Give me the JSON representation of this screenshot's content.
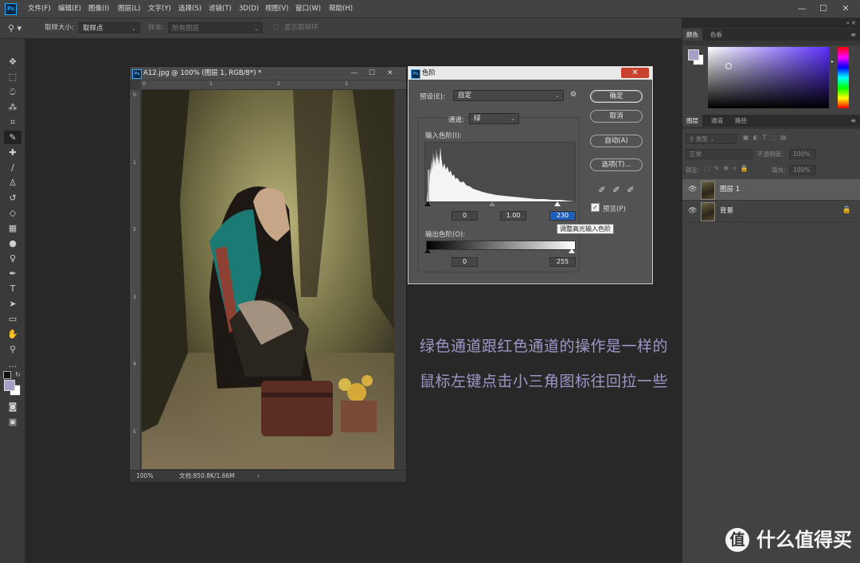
{
  "app": {
    "logo": "Ps"
  },
  "menu": [
    "文件(F)",
    "编辑(E)",
    "图像(I)",
    "图层(L)",
    "文字(Y)",
    "选择(S)",
    "滤镜(T)",
    "3D(D)",
    "视图(V)",
    "窗口(W)",
    "帮助(H)"
  ],
  "window_controls": {
    "minimize": "—",
    "maximize": "☐",
    "close": "✕"
  },
  "options_bar": {
    "sample_size_label": "取样大小:",
    "sample_size_value": "取样点",
    "sample_label": "样本:",
    "sample_value": "所有图层",
    "show_ring_label": "显示取样环"
  },
  "document": {
    "title": "A12.jpg @ 100% (图层 1, RGB/8*) *",
    "ruler_top": [
      "0",
      "1",
      "2",
      "3"
    ],
    "ruler_left": [
      "0",
      "1",
      "2",
      "3",
      "4",
      "5"
    ],
    "zoom": "100%",
    "doc_info": "文档:850.8K/1.66M"
  },
  "levels": {
    "title": "色阶",
    "preset_label": "预设(E):",
    "preset_value": "自定",
    "channel_label": "通道:",
    "channel_value": "绿",
    "input_levels_label": "输入色阶(I):",
    "input_black": "0",
    "input_gamma": "1.00",
    "input_white": "230",
    "output_levels_label": "输出色阶(O):",
    "output_black": "0",
    "output_white": "255",
    "buttons": {
      "ok": "确定",
      "cancel": "取消",
      "auto": "自动(A)",
      "options": "选项(T)..."
    },
    "preview_label": "预览(P)",
    "preview_checked": true,
    "close": "✕",
    "tooltip": "调整高光输入色阶"
  },
  "caption": {
    "line1": "绿色通道跟红色通道的操作是一样的",
    "line2": "鼠标左键点击小三角图标往回拉一些"
  },
  "panels": {
    "color_tabs": [
      "颜色",
      "色板"
    ],
    "foreground_color": "#a79fc6",
    "layers_tabs": [
      "图层",
      "通道",
      "路径"
    ],
    "kind_filter": "类型",
    "blend_mode": "正常",
    "opacity_label": "不透明度:",
    "opacity_value": "100%",
    "lock_label": "锁定:",
    "fill_label": "填充:",
    "fill_value": "100%",
    "layers": [
      {
        "name": "图层 1",
        "selected": true,
        "locked": false
      },
      {
        "name": "背景",
        "selected": false,
        "locked": true
      }
    ]
  },
  "watermark": {
    "logo": "值",
    "text": "什么值得买"
  }
}
